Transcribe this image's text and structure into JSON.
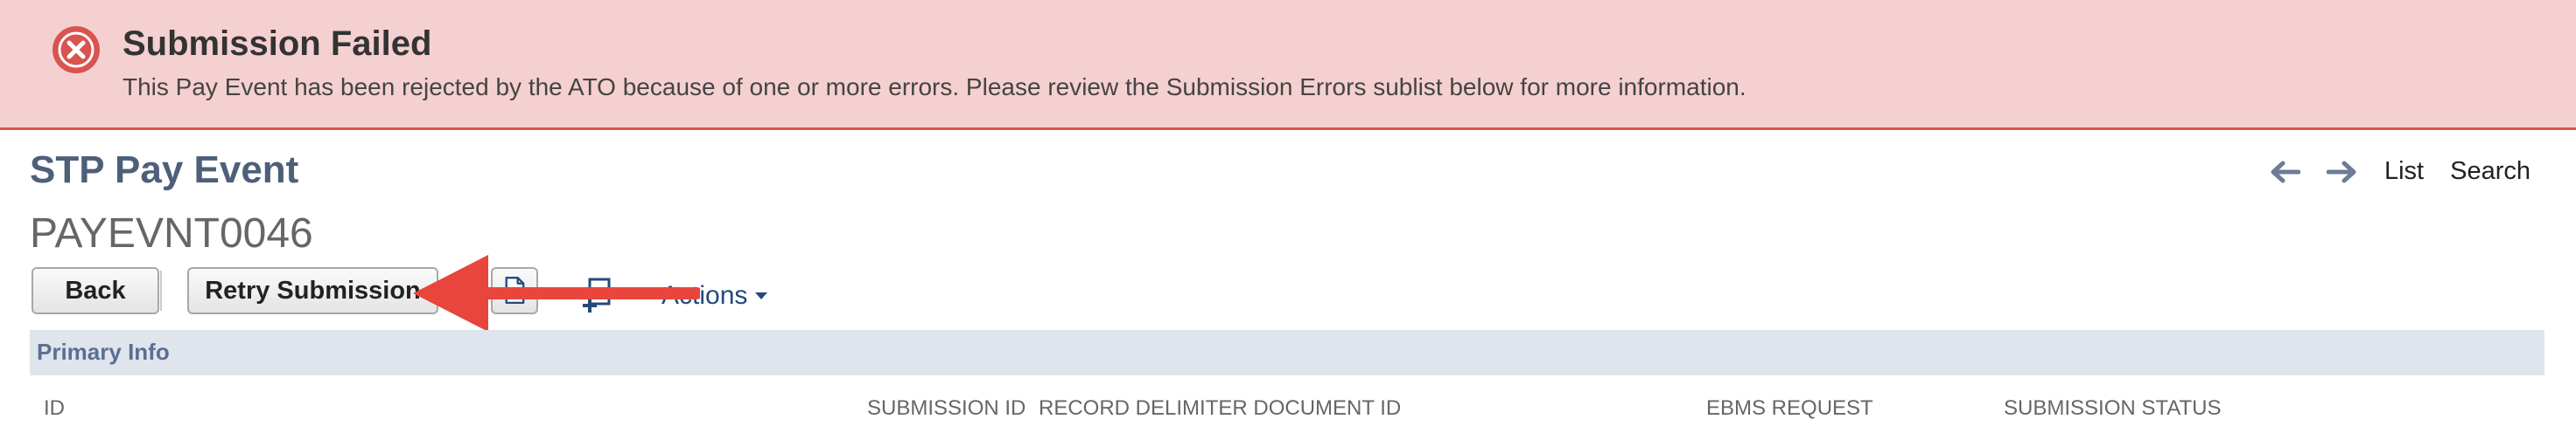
{
  "banner": {
    "title": "Submission Failed",
    "message": "This Pay Event has been rejected by the ATO because of one or more errors. Please review the Submission Errors sublist below for more information.",
    "icon": "error-circle-x-icon",
    "color_background": "#f5d0d0",
    "color_border": "#d9534f",
    "color_icon": "#d9534f"
  },
  "header": {
    "record_type": "STP Pay Event",
    "record_id": "PAYEVNT0046",
    "nav": {
      "prev_icon": "arrow-left-icon",
      "next_icon": "arrow-right-icon",
      "list_label": "List",
      "search_label": "Search"
    }
  },
  "toolbar": {
    "back_label": "Back",
    "retry_label": "Retry Submission",
    "print_icon": "document-icon",
    "new_record_icon": "new-document-icon",
    "actions_label": "Actions"
  },
  "annotation": {
    "arrow_color": "#e8453c",
    "points_to": "Retry Submission"
  },
  "primary_info": {
    "section_title": "Primary Info",
    "fields": [
      {
        "label": "ID"
      },
      {
        "label": "SUBMISSION ID"
      },
      {
        "label": "RECORD DELIMITER DOCUMENT ID"
      },
      {
        "label": "EBMS REQUEST"
      },
      {
        "label": "SUBMISSION STATUS"
      }
    ]
  },
  "colors": {
    "title_blue": "#4d5f79",
    "link_blue": "#24497d",
    "section_bg": "#e0e5ed",
    "section_text": "#5a6f92"
  }
}
